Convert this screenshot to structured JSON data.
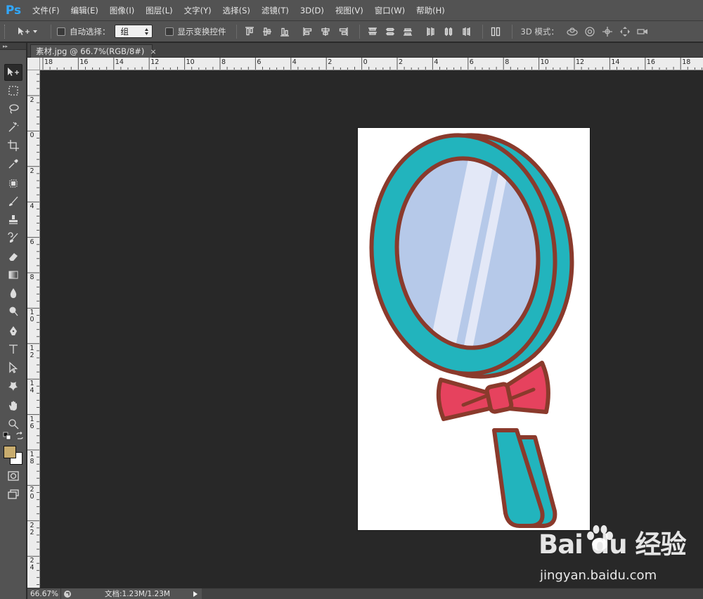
{
  "app": {
    "logo": "Ps"
  },
  "menu": [
    {
      "label": "文件(F)"
    },
    {
      "label": "编辑(E)"
    },
    {
      "label": "图像(I)"
    },
    {
      "label": "图层(L)"
    },
    {
      "label": "文字(Y)"
    },
    {
      "label": "选择(S)"
    },
    {
      "label": "滤镜(T)"
    },
    {
      "label": "3D(D)"
    },
    {
      "label": "视图(V)"
    },
    {
      "label": "窗口(W)"
    },
    {
      "label": "帮助(H)"
    }
  ],
  "options": {
    "auto_select_label": "自动选择：",
    "auto_select_value": "组",
    "show_transform_label": "显示变换控件",
    "mode3d_label": "3D 模式："
  },
  "document": {
    "tab_title": "素材.jpg @ 66.7%(RGB/8#)",
    "tab_close": "×"
  },
  "ruler": {
    "h_labels": [
      "18",
      "16",
      "14",
      "12",
      "10",
      "8",
      "6",
      "4",
      "2",
      "0",
      "2",
      "4",
      "6",
      "8",
      "10",
      "12",
      "14",
      "16",
      "18"
    ],
    "v_labels": [
      "2",
      "0",
      "2",
      "4",
      "6",
      "8",
      "10",
      "12",
      "14",
      "16",
      "18",
      "20",
      "22",
      "24"
    ]
  },
  "status": {
    "zoom": "66.67%",
    "doc_size": "文档:1.23M/1.23M"
  },
  "watermark": {
    "brand": "Bai du 经验",
    "url": "jingyan.baidu.com"
  },
  "colors": {
    "foreground": "#c8ac6e",
    "background": "#ffffff",
    "mirror_frame": "#22b4bd",
    "mirror_outline": "#8a3a2c",
    "mirror_glass": "#b6c9e9",
    "bow": "#e6425e"
  }
}
